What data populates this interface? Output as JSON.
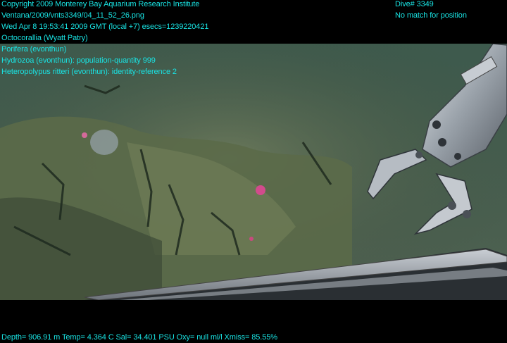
{
  "header": {
    "copyright": "Copyright 2009 Monterey Bay Aquarium Research Institute",
    "file_path": "Ventana/2009/vnts3349/04_11_52_26.png",
    "timestamp": "Wed Apr  8 19:53:41 2009 GMT (local +7)  esecs=1239220421",
    "dive": "Dive# 3349",
    "position_status": "No match for position"
  },
  "annotations": [
    "Octocorallia (Wyatt Patry)",
    "Porifera (evonthun)",
    "Hydrozoa (evonthun): population-quantity 999",
    "Heteropolypus ritteri (evonthun): identity-reference 2"
  ],
  "telemetry": {
    "line": "Depth= 906.91 m  Temp= 4.364 C  Sal= 34.401 PSU  Oxy= null ml/l  Xmiss= 85.55%"
  },
  "colors": {
    "overlay_text": "#19e3e3",
    "seafloor": "#5f6e4c",
    "water": "#3b5647"
  }
}
